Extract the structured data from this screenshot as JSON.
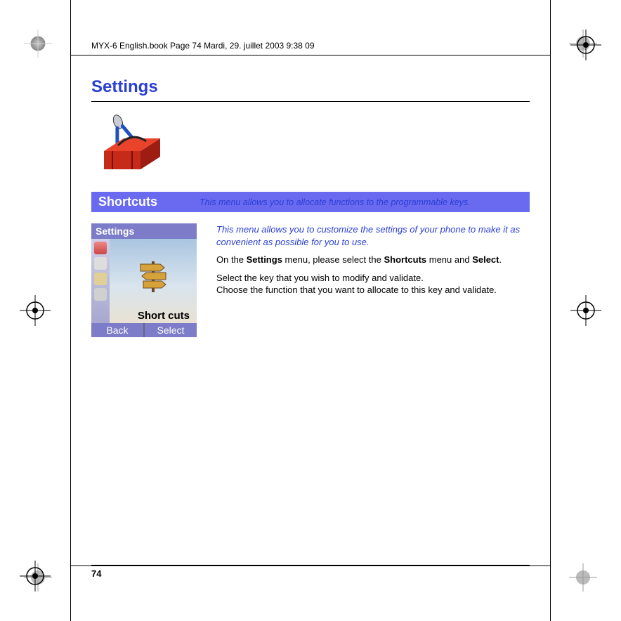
{
  "header": "MYX-6 English.book  Page 74  Mardi, 29. juillet 2003  9:38 09",
  "page_title": "Settings",
  "section": {
    "title": "Shortcuts",
    "description": "This menu allows you to allocate functions to the programmable keys."
  },
  "phone": {
    "header": "Settings",
    "label": "Short cuts",
    "softkey_left": "Back",
    "softkey_right": "Select"
  },
  "body": {
    "intro": "This menu allows you to customize the settings of your phone to make it as convenient as possible for you to use.",
    "line2_pre": "On the ",
    "line2_b1": "Settings",
    "line2_mid": " menu, please select the ",
    "line2_b2": "Shortcuts",
    "line2_mid2": " menu and ",
    "line2_b3": "Select",
    "line2_end": ".",
    "line3a": "Select the key that you wish to modify and validate.",
    "line3b": "Choose the function that you want to allocate to this key and validate."
  },
  "page_number": "74"
}
